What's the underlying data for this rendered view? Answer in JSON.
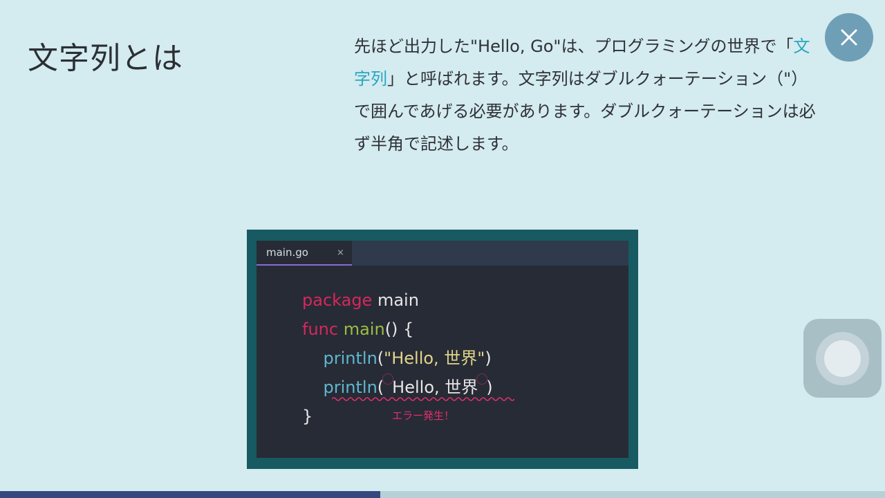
{
  "title": "文字列とは",
  "description": {
    "part1": "先ほど出力した\"Hello, Go\"は、プログラミングの世界で「",
    "highlight": "文字列",
    "part2": "」と呼ばれます。文字列はダブルクォーテーション（\"）で囲んであげる必要があります。ダブルクォーテーションは必ず半角で記述します。"
  },
  "close_icon": "close-icon",
  "editor": {
    "tab_label": "main.go",
    "tab_close": "×",
    "lines": {
      "l1_kw": "package",
      "l1_rest": " main",
      "l2_kw": "func",
      "l2_fn": "main",
      "l2_rest": "() {",
      "l3_fn": "println",
      "l3_open": "(",
      "l3_str": "\"Hello, 世界\"",
      "l3_close": ")",
      "l4_fn": "println",
      "l4_open": "(",
      "l4_text": "Hello, 世界",
      "l4_close": ")",
      "l5": "}"
    },
    "error_note": "エラー発生！",
    "colors": {
      "keyword": "#d7275e",
      "function": "#9dbc44",
      "builtin": "#5fb7cf",
      "string": "#e1d58c",
      "error": "#e2306c"
    }
  },
  "progress": {
    "fraction": 0.43
  },
  "accent": "#2aa6c0"
}
